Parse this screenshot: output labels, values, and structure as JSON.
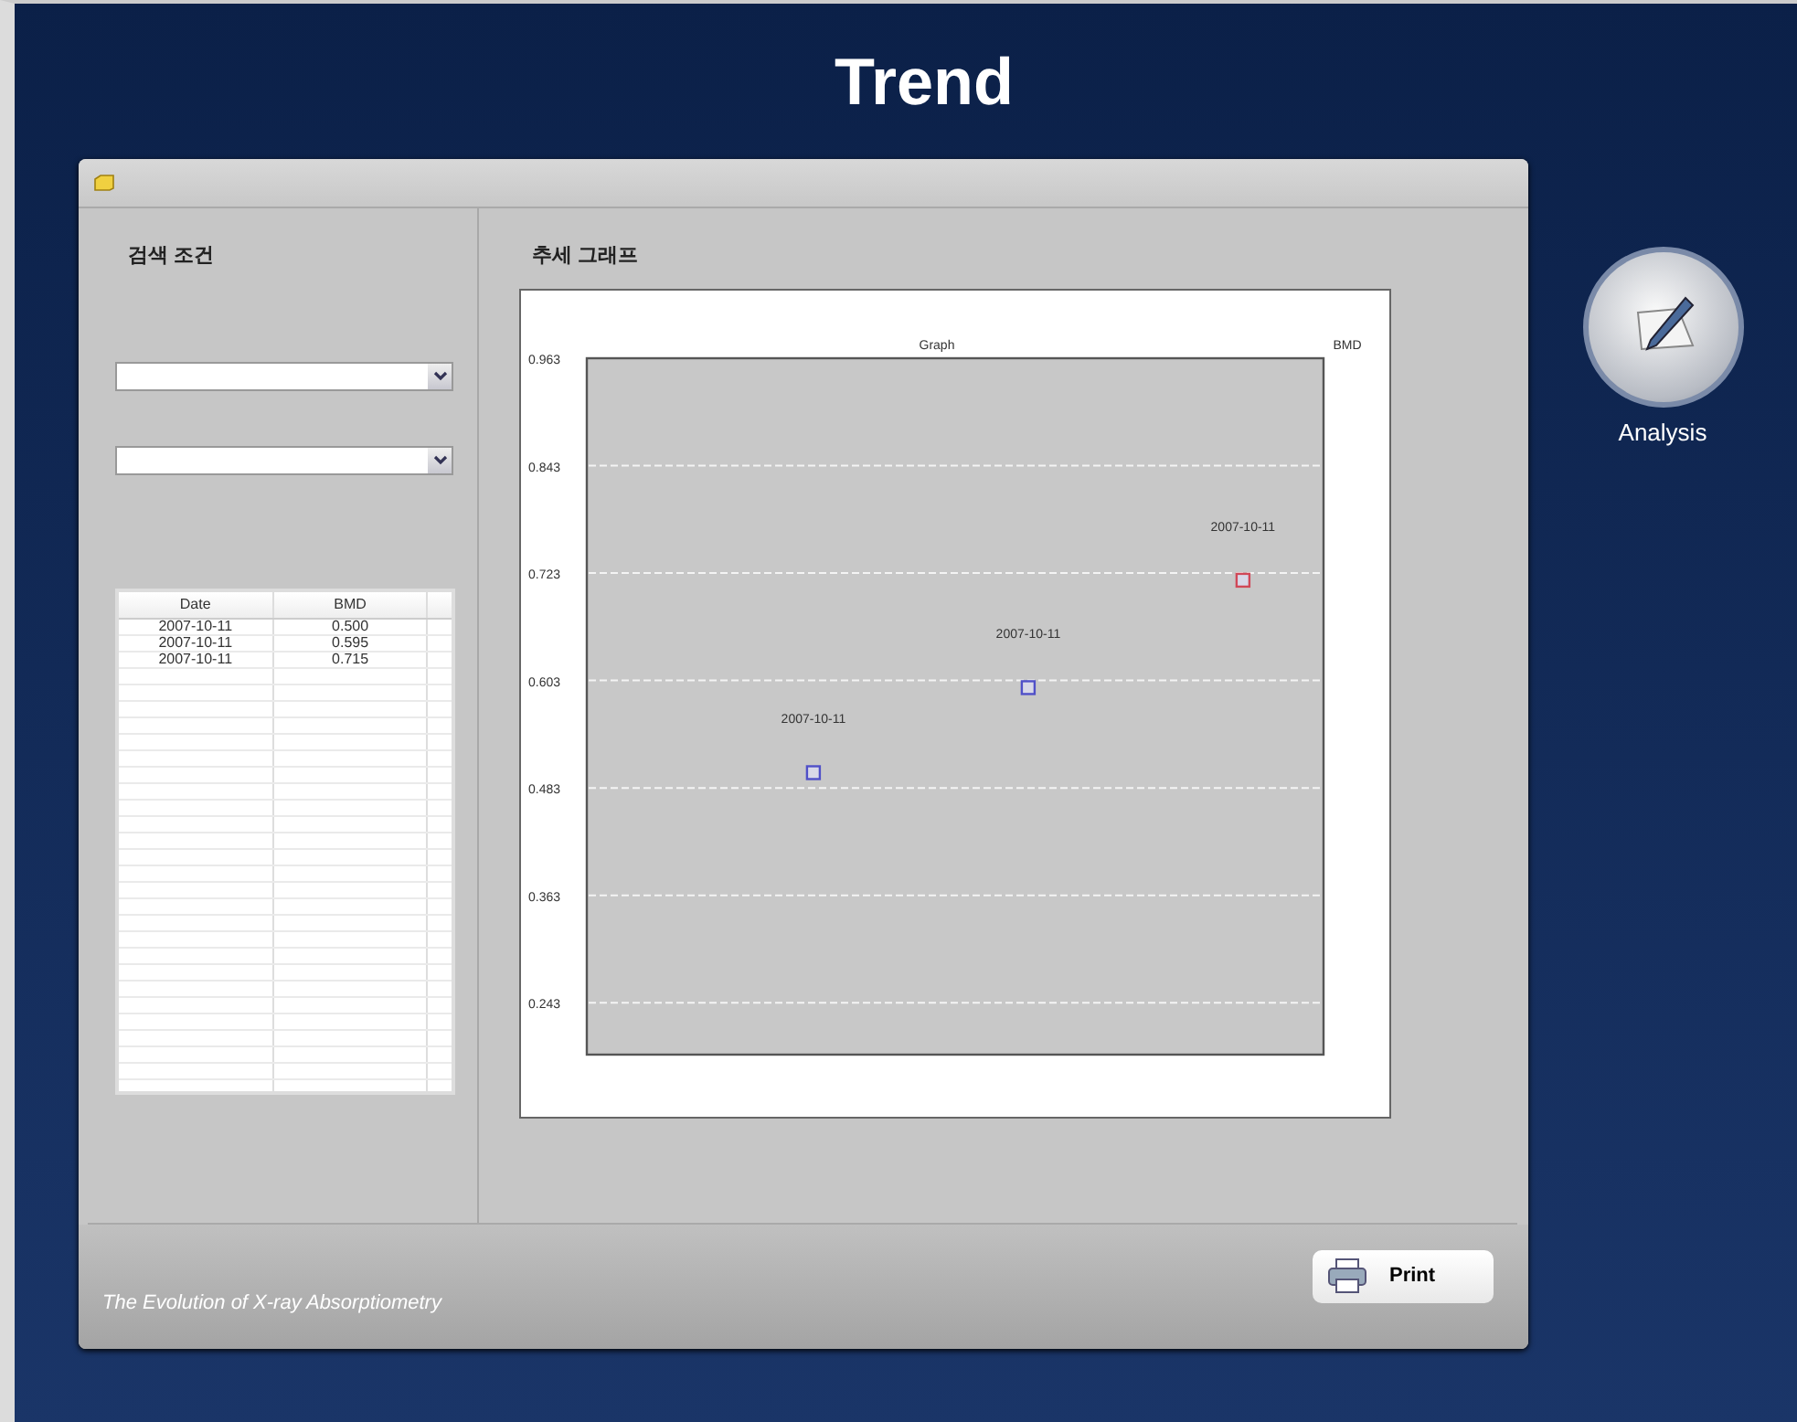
{
  "title": "Trend",
  "search": {
    "heading": "검색 조건"
  },
  "table": {
    "columns": [
      "Date",
      "BMD"
    ],
    "rows": [
      [
        "2007-10-11",
        "0.500"
      ],
      [
        "2007-10-11",
        "0.595"
      ],
      [
        "2007-10-11",
        "0.715"
      ]
    ]
  },
  "graph": {
    "heading": "추세 그래프",
    "chart_data": {
      "type": "scatter",
      "title": "Graph",
      "ylabel": "BMD",
      "categories": [
        null,
        null,
        null
      ],
      "ylim": [
        0.185,
        0.963
      ],
      "yticks": [
        {
          "value": 0.963,
          "label": "0.963"
        },
        {
          "value": 0.843,
          "label": "0.843"
        },
        {
          "value": 0.723,
          "label": "0.723"
        },
        {
          "value": 0.603,
          "label": "0.603"
        },
        {
          "value": 0.483,
          "label": "0.483"
        },
        {
          "value": 0.363,
          "label": "0.363"
        },
        {
          "value": 0.243,
          "label": "0.243"
        }
      ],
      "series": [
        {
          "color": "#5050c8",
          "values": [
            0.5,
            0.595,
            null
          ]
        },
        {
          "color": "#d04858",
          "values": [
            null,
            null,
            0.715
          ]
        }
      ],
      "annotations": [
        "2007-10-11",
        "2007-10-11",
        "2007-10-11"
      ],
      "grid": true
    }
  },
  "footer": {
    "tagline": "The Evolution of X-ray Absorptiometry",
    "print_button": "Print"
  },
  "side": {
    "analysis_label": "Analysis"
  }
}
